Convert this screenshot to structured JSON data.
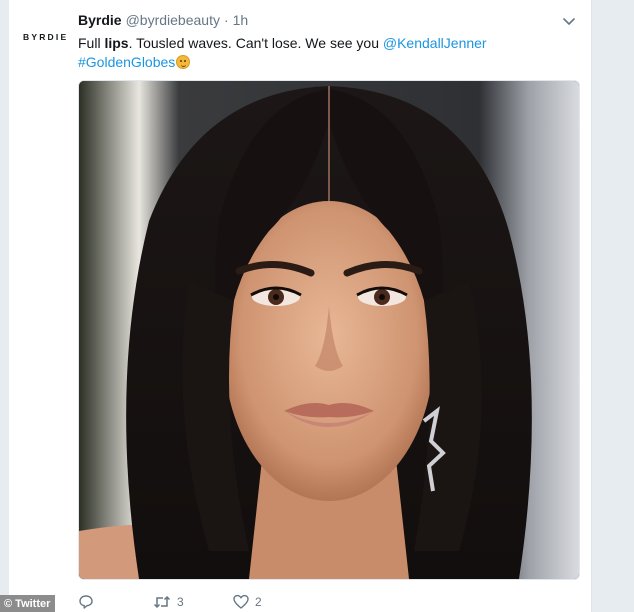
{
  "tweet": {
    "avatar_text": "BYRDIE",
    "display_name": "Byrdie",
    "handle": "@byrdiebeauty",
    "separator": "·",
    "time": "1h",
    "text_part1": "Full ",
    "text_bold": "lips",
    "text_part2": ". Tousled waves. Can't lose. We see you ",
    "mention": "@KendallJenner",
    "hashtag": "#GoldenGlobes",
    "emoji_icon": "face-emoji-icon",
    "photo_alt": "Close-up photo of a woman with dark shoulder-length wavy hair"
  },
  "actions": {
    "reply_count": "",
    "retweet_count": "3",
    "like_count": "2"
  },
  "watermark": {
    "label": "© Twitter"
  },
  "colors": {
    "link": "#1b95e0",
    "secondary": "#657786",
    "text": "#14171a"
  }
}
